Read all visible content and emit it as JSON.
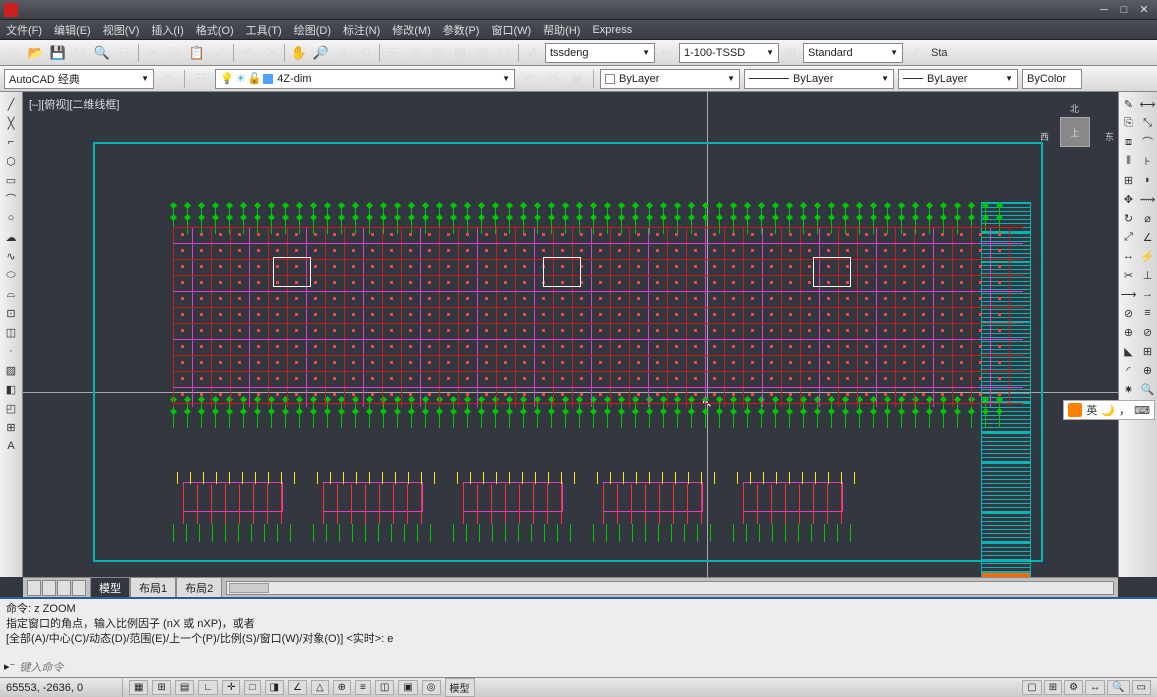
{
  "title": "",
  "menu": [
    "文件(F)",
    "编辑(E)",
    "视图(V)",
    "插入(I)",
    "格式(O)",
    "工具(T)",
    "绘图(D)",
    "标注(N)",
    "修改(M)",
    "参数(P)",
    "窗口(W)",
    "帮助(H)",
    "Express"
  ],
  "workspace": {
    "name": "AutoCAD 经典"
  },
  "layer": {
    "current": "4Z-dim"
  },
  "textstyle": {
    "name": "tssdeng"
  },
  "dimstyle": {
    "name": "1-100-TSSD"
  },
  "tablestyle": {
    "name": "Standard"
  },
  "extra_label": "Sta",
  "bycolor": "ByColor",
  "bylayer1": "ByLayer",
  "bylayer2": "ByLayer",
  "bylayer3": "ByLayer",
  "view_label": "[–][俯视][二维线框]",
  "viewcube": {
    "top": "上",
    "north": "北",
    "east": "东",
    "west": "西"
  },
  "tabs": {
    "model": "模型",
    "layout1": "布局1",
    "layout2": "布局2"
  },
  "cmd": {
    "l1": "命令: z ZOOM",
    "l2": "指定窗口的角点，输入比例因子 (nX 或 nXP)，或者",
    "l3": "[全部(A)/中心(C)/动态(D)/范围(E)/上一个(P)/比例(S)/窗口(W)/对象(O)] <实时>: e",
    "placeholder": "键入命令"
  },
  "status": {
    "coords": "65553, -2636, 0",
    "modelbtn": "模型"
  },
  "ime": {
    "label": "英"
  }
}
